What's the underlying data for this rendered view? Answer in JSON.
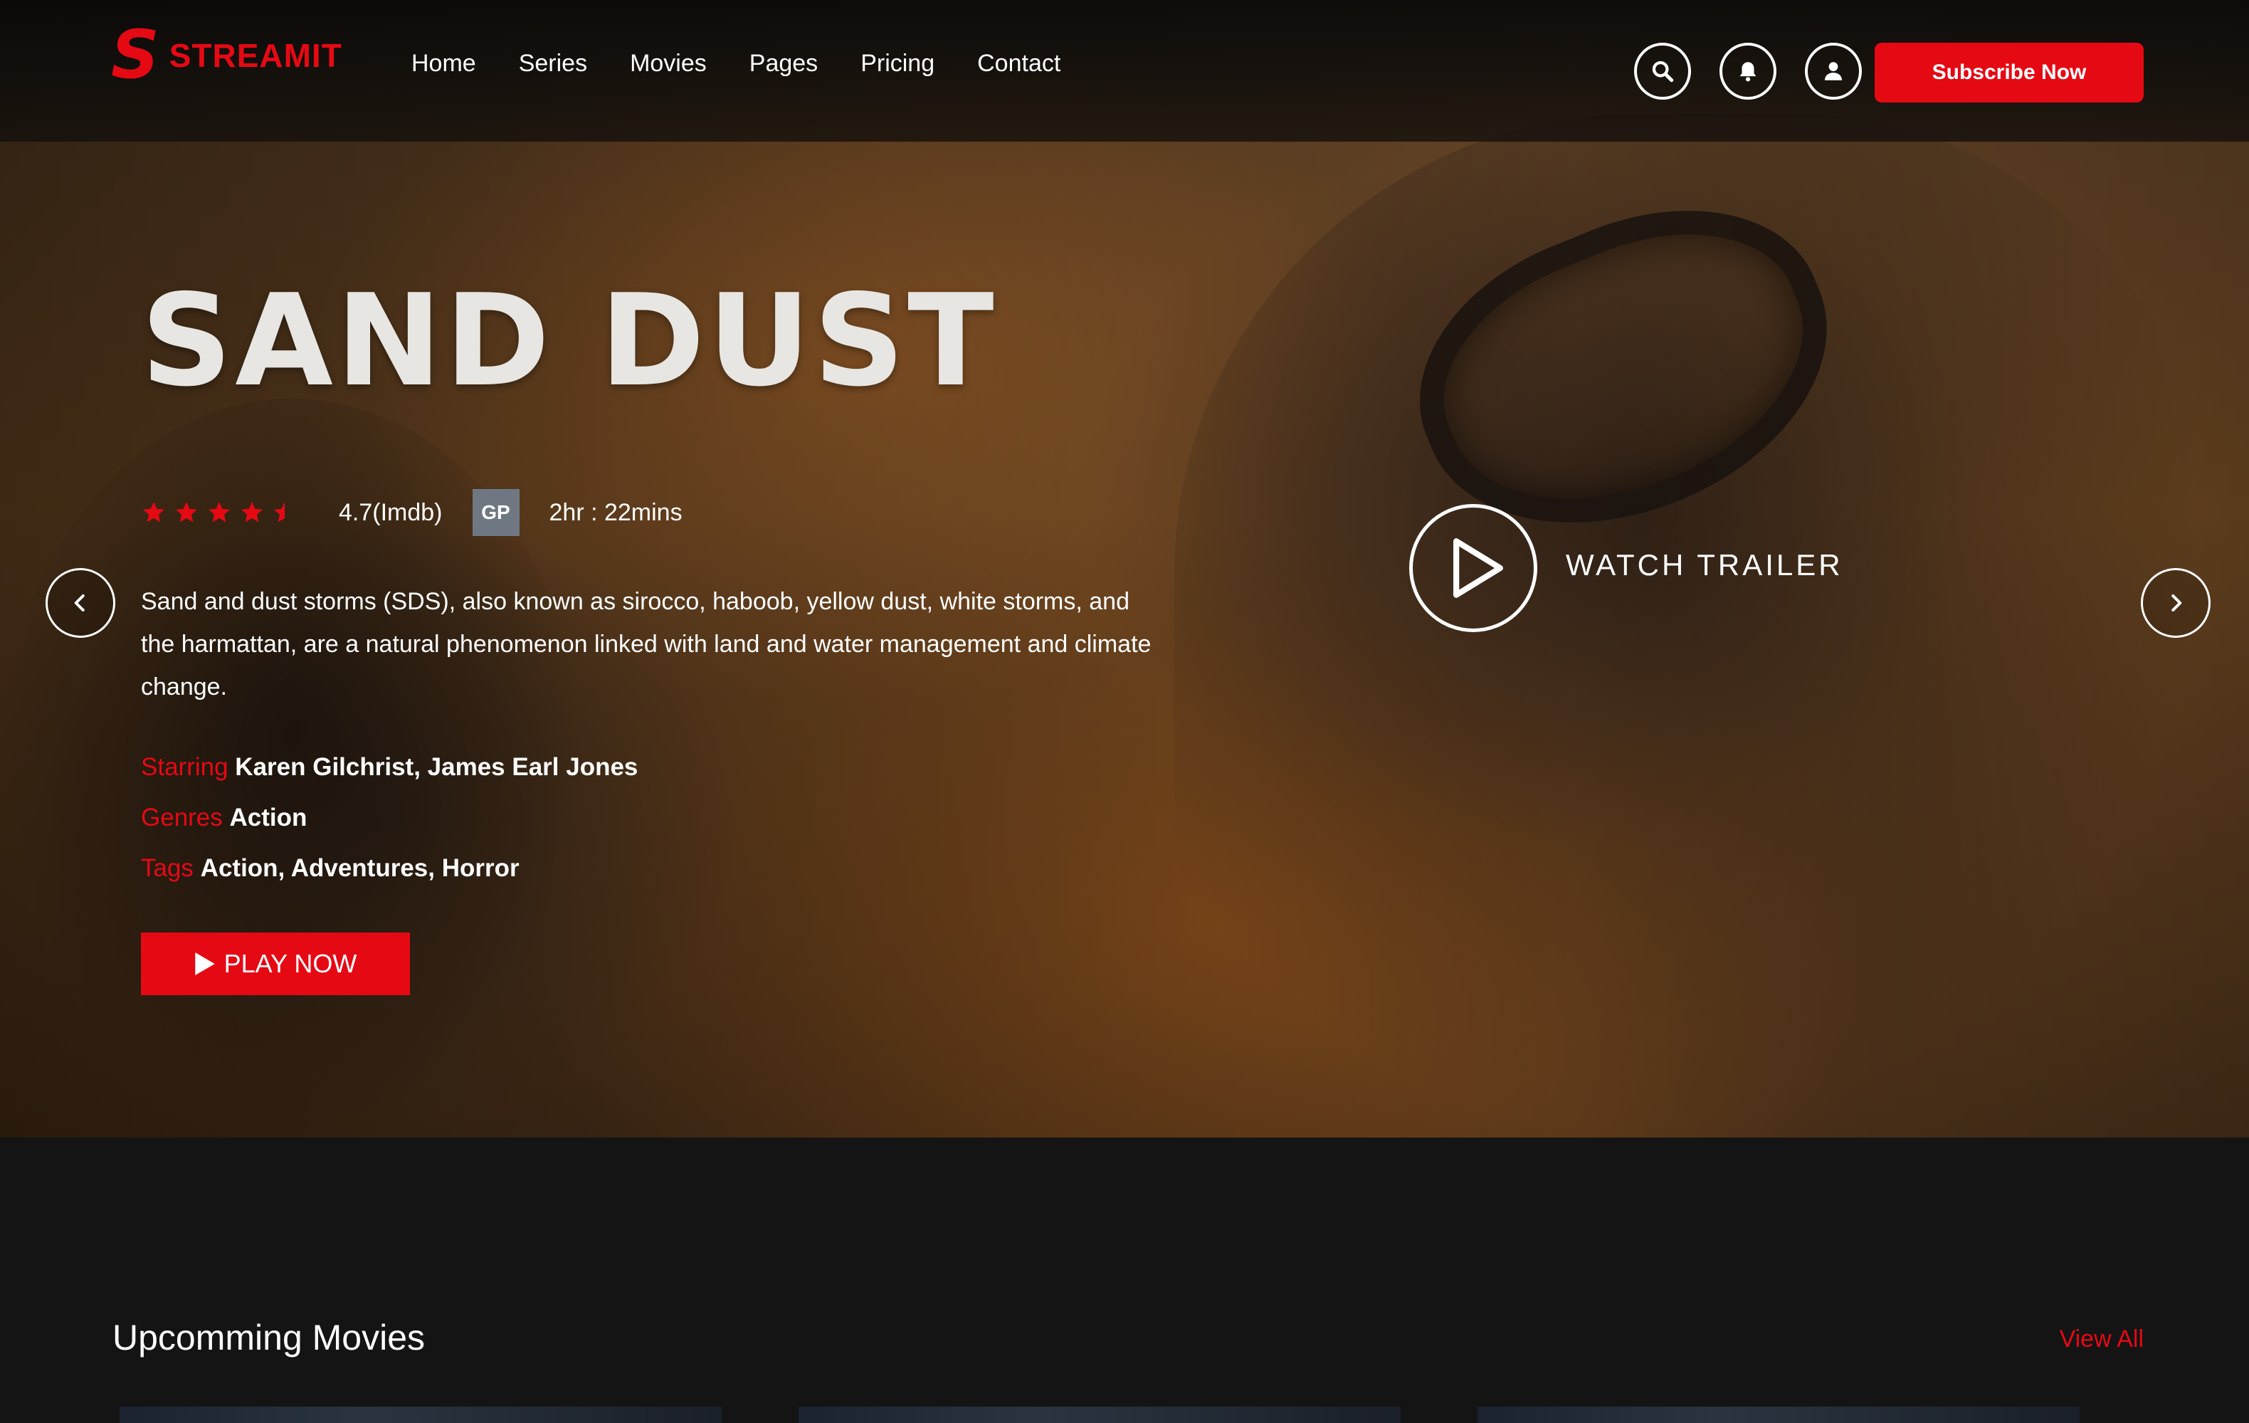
{
  "brand": {
    "logo_letter": "S",
    "name": "STREAMIT",
    "accent_color": "#e50914"
  },
  "nav": {
    "items": [
      "Home",
      "Series",
      "Movies",
      "Pages",
      "Pricing",
      "Contact"
    ]
  },
  "header_actions": {
    "icons": [
      "search-icon",
      "bell-icon",
      "user-icon"
    ],
    "subscribe_label": "Subscribe Now"
  },
  "hero": {
    "title": "SAND DUST",
    "rating_stars": 4.5,
    "rating_text": "4.7(Imdb)",
    "content_rating": "GP",
    "duration": "2hr : 22mins",
    "description": "Sand and dust storms (SDS), also known as sirocco, haboob, yellow dust, white storms, and the harmattan, are a natural phenomenon linked with land and water management and climate change.",
    "starring_label": "Starring",
    "starring_value": "Karen Gilchrist, James Earl Jones",
    "genres_label": "Genres",
    "genres_value": "Action",
    "tags_label": "Tags",
    "tags_value": "Action, Adventures, Horror",
    "play_label": "PLAY NOW",
    "trailer_label": "WATCH TRAILER"
  },
  "upcoming": {
    "title": "Upcomming Movies",
    "view_all": "View All"
  }
}
